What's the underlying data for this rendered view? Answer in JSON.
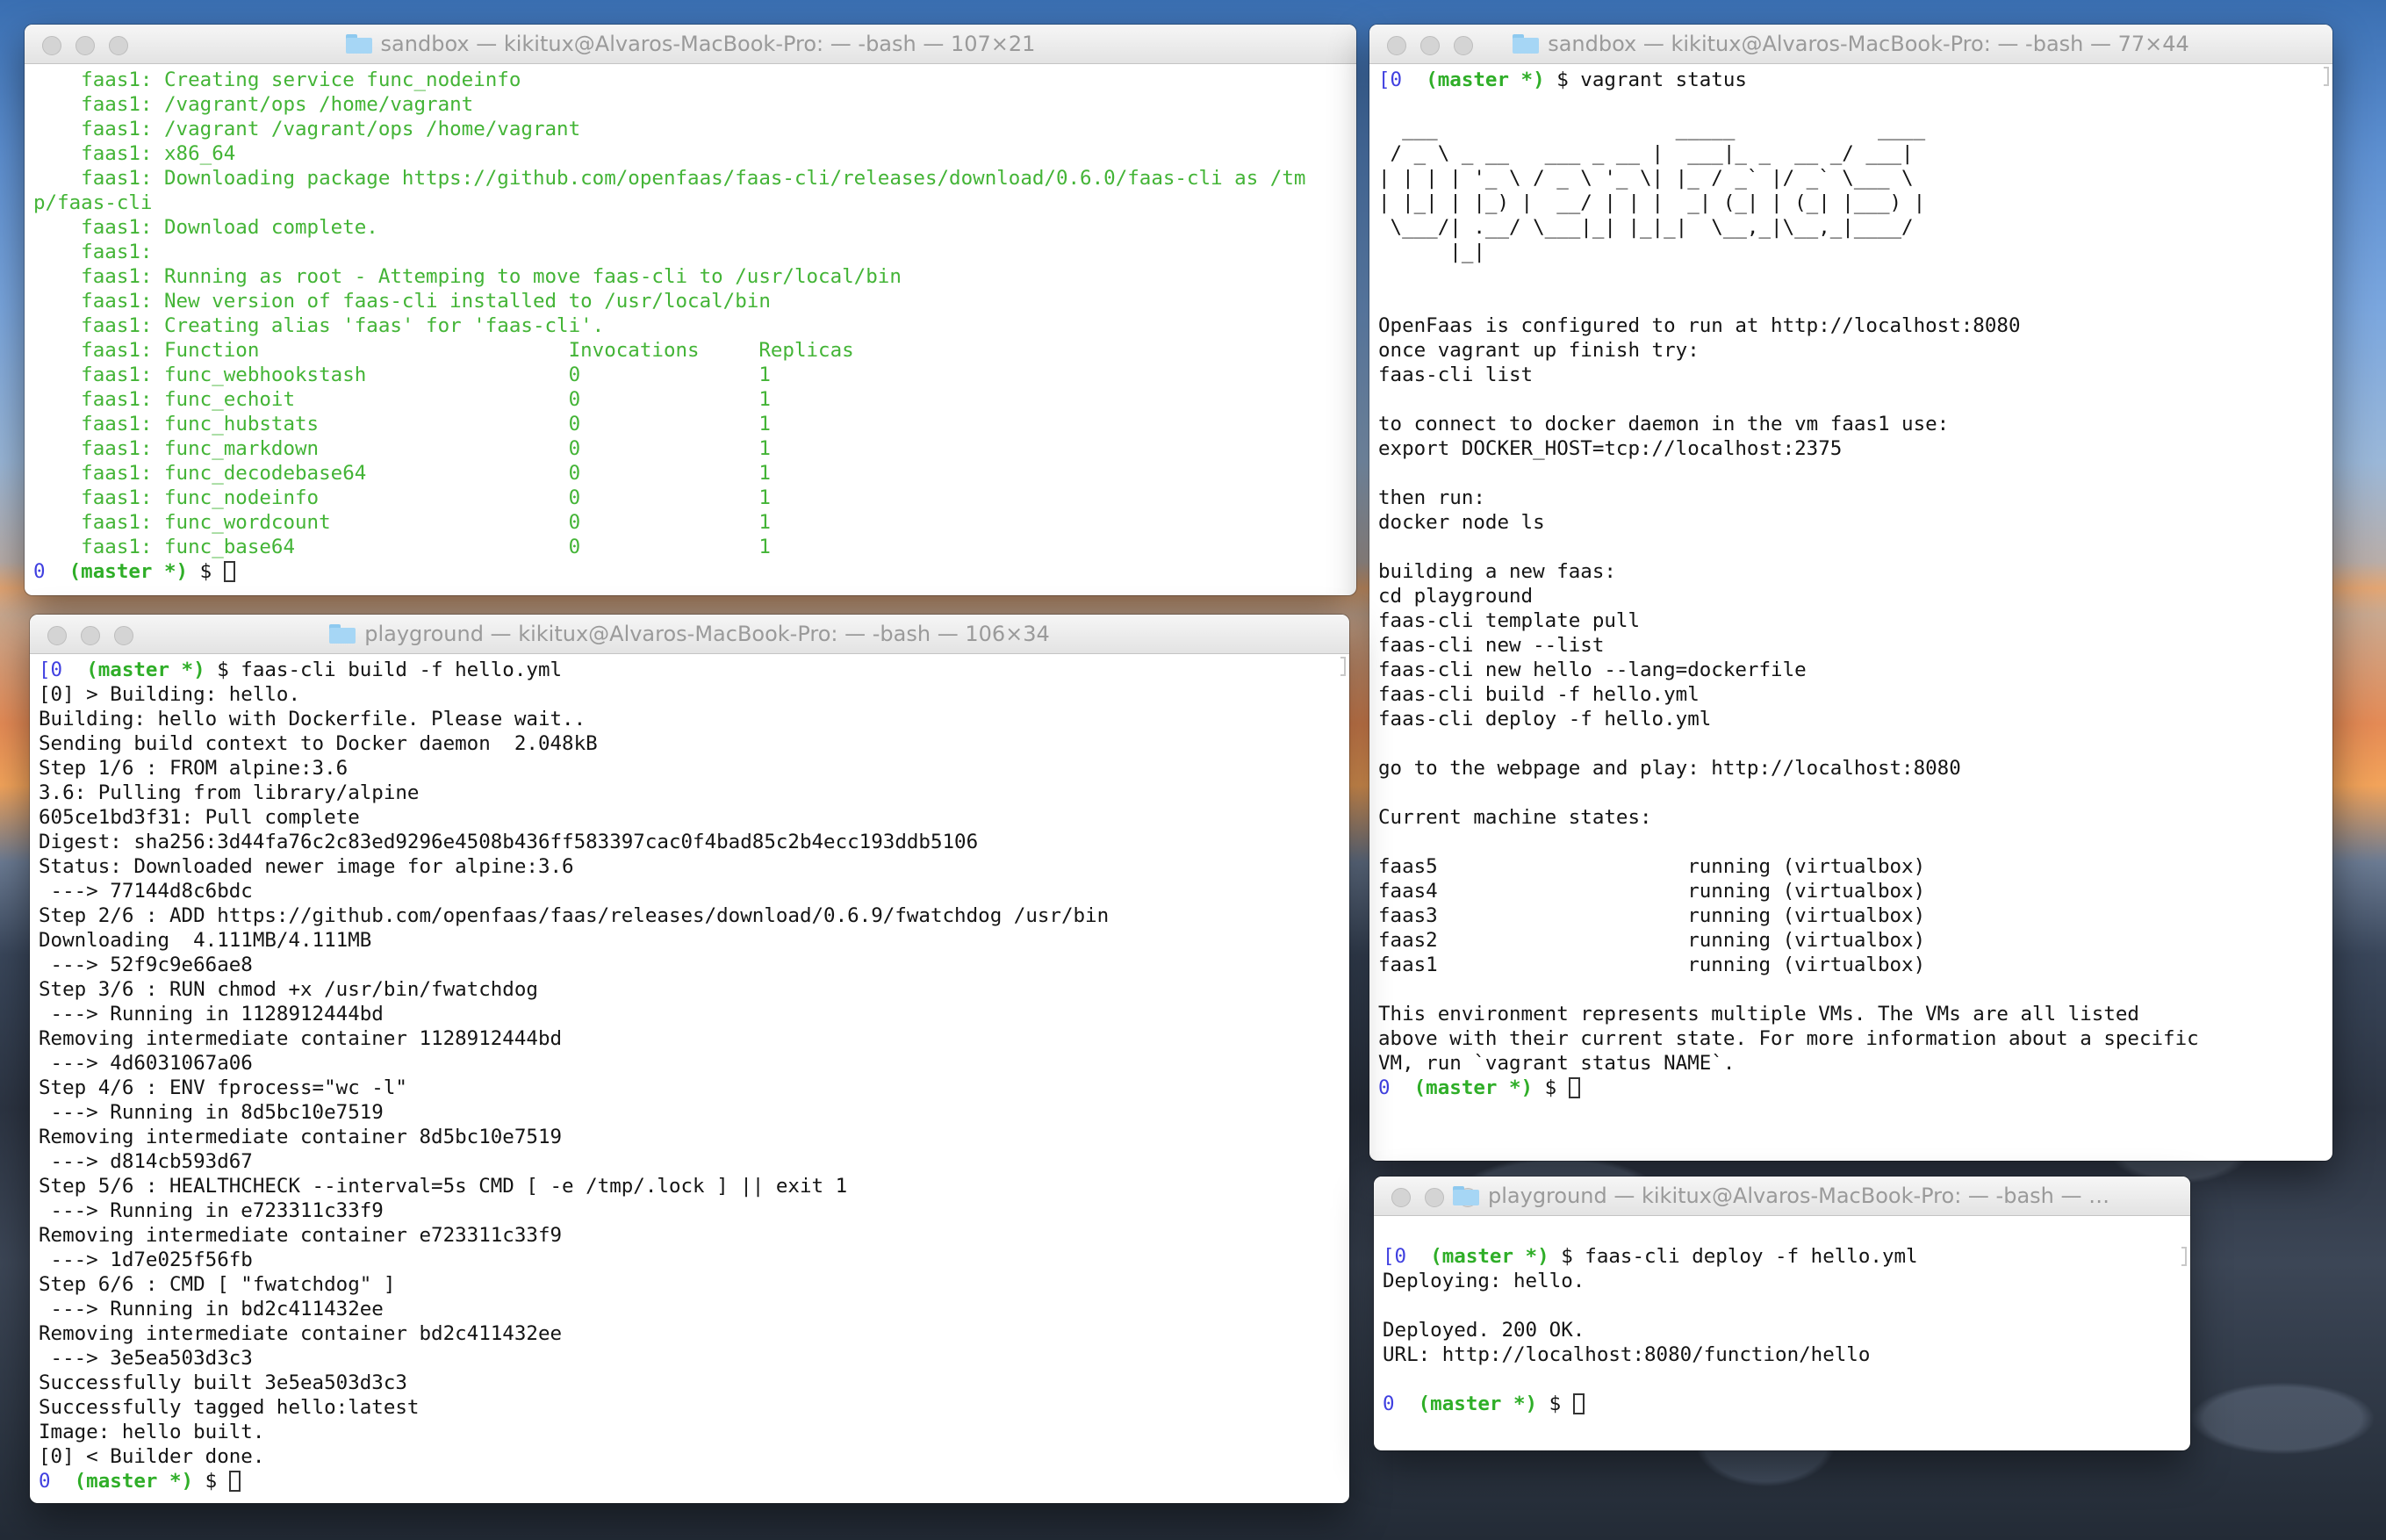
{
  "windows": {
    "sandbox1": {
      "title": "sandbox — kikitux@Alvaros-MacBook-Pro: — -bash — 107×21",
      "lines": [
        "    faas1: Creating service func_nodeinfo",
        "    faas1: /vagrant/ops /home/vagrant",
        "    faas1: /vagrant /vagrant/ops /home/vagrant",
        "    faas1: x86_64",
        "    faas1: Downloading package https://github.com/openfaas/faas-cli/releases/download/0.6.0/faas-cli as /tm",
        "p/faas-cli",
        "    faas1: Download complete.",
        "    faas1:",
        "    faas1: Running as root - Attemping to move faas-cli to /usr/local/bin",
        "    faas1: New version of faas-cli installed to /usr/local/bin",
        "    faas1: Creating alias 'faas' for 'faas-cli'.",
        "    faas1: Function                          Invocations     Replicas",
        "    faas1: func_webhookstash                 0               1",
        "    faas1: func_echoit                       0               1",
        "    faas1: func_hubstats                     0               1",
        "    faas1: func_markdown                     0               1",
        "    faas1: func_decodebase64                 0               1",
        "    faas1: func_nodeinfo                     0               1",
        "    faas1: func_wordcount                    0               1",
        "    faas1: func_base64                       0               1"
      ],
      "prompt": {
        "num": "0",
        "branch": "(master *)",
        "symbol": "$"
      }
    },
    "sandbox2": {
      "title": "sandbox — kikitux@Alvaros-MacBook-Pro: — -bash — 77×44",
      "prompt_top": {
        "num": "[0",
        "branch": "(master *)",
        "command": "$ vagrant status"
      },
      "lines": [
        "",
        "  ___                    _____            ____",
        " / _ \\ _ __   ___ _ __ |  ___|_ _  __ _/ ___|",
        "| | | | '_ \\ / _ \\ '_ \\| |_ / _` |/ _` \\___ \\",
        "| |_| | |_) |  __/ | | |  _| (_| | (_| |___) |",
        " \\___/| .__/ \\___|_| |_|_|  \\__,_|\\__,_|____/",
        "      |_|",
        "",
        "",
        "OpenFaas is configured to run at http://localhost:8080",
        "once vagrant up finish try:",
        "faas-cli list",
        "",
        "to connect to docker daemon in the vm faas1 use:",
        "export DOCKER_HOST=tcp://localhost:2375",
        "",
        "then run:",
        "docker node ls",
        "",
        "building a new faas:",
        "cd playground",
        "faas-cli template pull",
        "faas-cli new --list",
        "faas-cli new hello --lang=dockerfile",
        "faas-cli build -f hello.yml",
        "faas-cli deploy -f hello.yml",
        "",
        "go to the webpage and play: http://localhost:8080",
        "",
        "Current machine states:",
        "",
        "faas5                     running (virtualbox)",
        "faas4                     running (virtualbox)",
        "faas3                     running (virtualbox)",
        "faas2                     running (virtualbox)",
        "faas1                     running (virtualbox)",
        "",
        "This environment represents multiple VMs. The VMs are all listed",
        "above with their current state. For more information about a specific",
        "VM, run `vagrant status NAME`."
      ],
      "prompt": {
        "num": "0",
        "branch": "(master *)",
        "symbol": "$"
      }
    },
    "playground1": {
      "title": "playground — kikitux@Alvaros-MacBook-Pro: — -bash — 106×34",
      "prompt_top": {
        "num": "[0",
        "branch": "(master *)",
        "command": "$ faas-cli build -f hello.yml"
      },
      "lines": [
        "[0] > Building: hello.",
        "Building: hello with Dockerfile. Please wait..",
        "Sending build context to Docker daemon  2.048kB",
        "Step 1/6 : FROM alpine:3.6",
        "3.6: Pulling from library/alpine",
        "605ce1bd3f31: Pull complete",
        "Digest: sha256:3d44fa76c2c83ed9296e4508b436ff583397cac0f4bad85c2b4ecc193ddb5106",
        "Status: Downloaded newer image for alpine:3.6",
        " ---> 77144d8c6bdc",
        "Step 2/6 : ADD https://github.com/openfaas/faas/releases/download/0.6.9/fwatchdog /usr/bin",
        "Downloading  4.111MB/4.111MB",
        " ---> 52f9c9e66ae8",
        "Step 3/6 : RUN chmod +x /usr/bin/fwatchdog",
        " ---> Running in 1128912444bd",
        "Removing intermediate container 1128912444bd",
        " ---> 4d6031067a06",
        "Step 4/6 : ENV fprocess=\"wc -l\"",
        " ---> Running in 8d5bc10e7519",
        "Removing intermediate container 8d5bc10e7519",
        " ---> d814cb593d67",
        "Step 5/6 : HEALTHCHECK --interval=5s CMD [ -e /tmp/.lock ] || exit 1",
        " ---> Running in e723311c33f9",
        "Removing intermediate container e723311c33f9",
        " ---> 1d7e025f56fb",
        "Step 6/6 : CMD [ \"fwatchdog\" ]",
        " ---> Running in bd2c411432ee",
        "Removing intermediate container bd2c411432ee",
        " ---> 3e5ea503d3c3",
        "Successfully built 3e5ea503d3c3",
        "Successfully tagged hello:latest",
        "Image: hello built.",
        "[0] < Builder done."
      ],
      "prompt": {
        "num": "0",
        "branch": "(master *)",
        "symbol": "$"
      }
    },
    "playground2": {
      "title": "playground — kikitux@Alvaros-MacBook-Pro: — -bash — 6...",
      "prompt_top": {
        "num": "[0",
        "branch": "(master *)",
        "command": "$ faas-cli deploy -f hello.yml"
      },
      "lines": [
        "Deploying: hello.",
        "",
        "Deployed. 200 OK.",
        "URL: http://localhost:8080/function/hello",
        ""
      ],
      "prompt": {
        "num": "0",
        "branch": "(master *)",
        "symbol": "$"
      }
    }
  },
  "icons": {
    "traffic_lights": [
      "close-icon",
      "minimize-icon",
      "zoom-icon"
    ],
    "title_icon": "folder-icon"
  },
  "colors": {
    "output_green": "#43b436",
    "prompt_blue": "#3f3fe0",
    "prompt_green": "#2fae28"
  }
}
